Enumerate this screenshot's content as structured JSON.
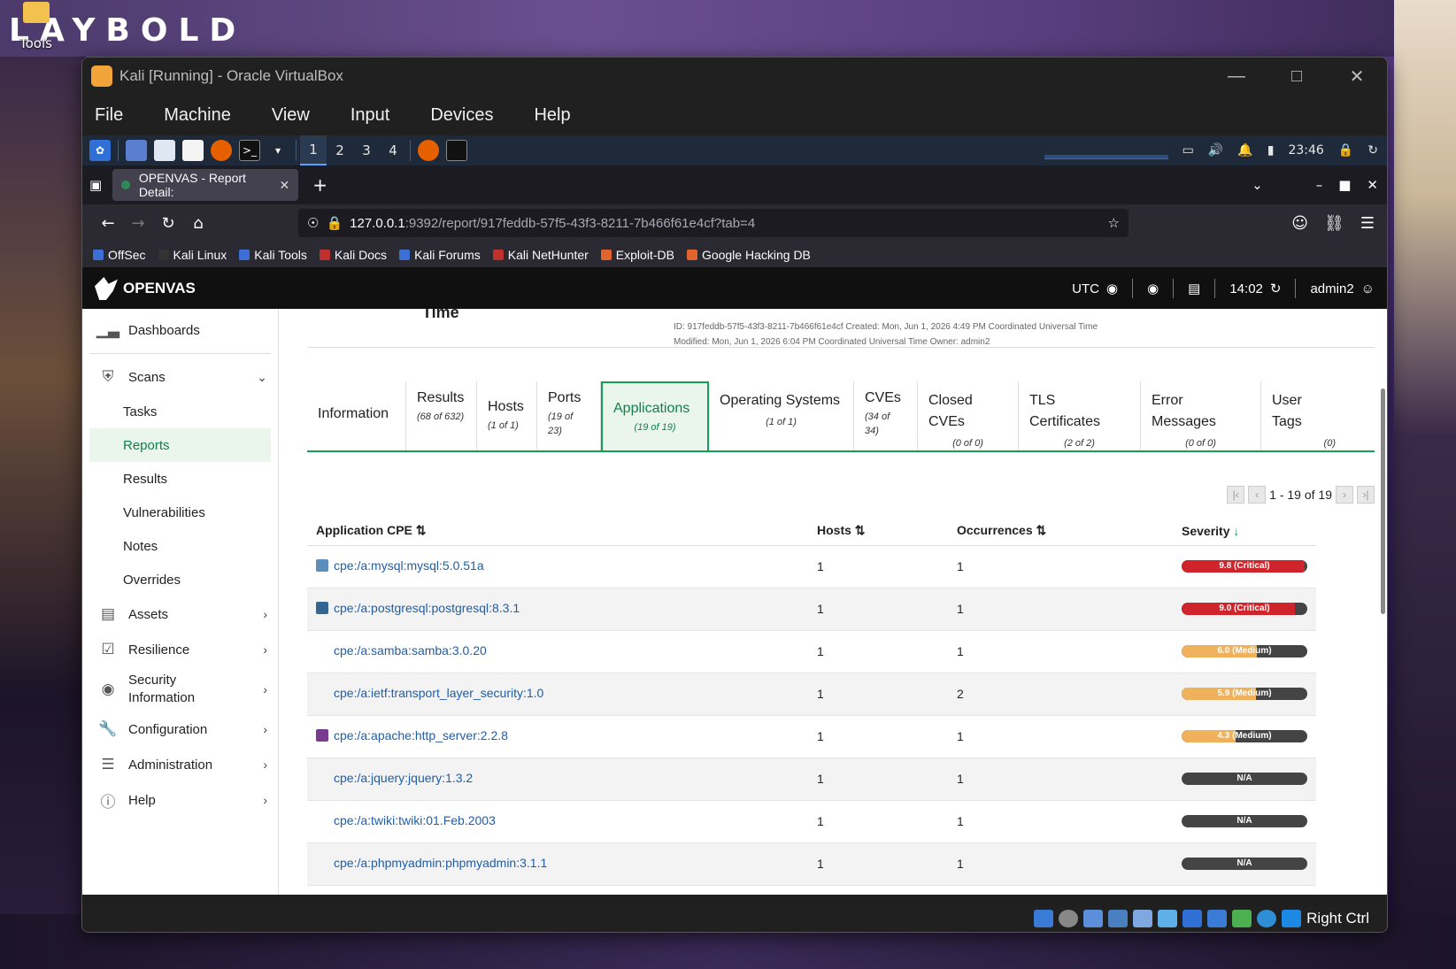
{
  "desktop": {
    "logo": "LAYBOLD",
    "tools_label": "Tools"
  },
  "vbox": {
    "title": "Kali [Running] - Oracle VirtualBox",
    "menu": [
      "File",
      "Machine",
      "View",
      "Input",
      "Devices",
      "Help"
    ],
    "status_right": "Right Ctrl"
  },
  "kali_panel": {
    "workspaces": [
      "1",
      "2",
      "3",
      "4"
    ],
    "clock": "23:46"
  },
  "firefox": {
    "tab_title": "OPENVAS - Report Detail:",
    "url_host": "127.0.0.1",
    "url_path": ":9392/report/917feddb-57f5-43f3-8211-7b466f61e4cf?tab=4",
    "bookmarks": [
      "OffSec",
      "Kali Linux",
      "Kali Tools",
      "Kali Docs",
      "Kali Forums",
      "Kali NetHunter",
      "Exploit-DB",
      "Google Hacking DB"
    ]
  },
  "openvas": {
    "brand": "OPENVAS",
    "timezone": "UTC",
    "time": "14:02",
    "user": "admin2",
    "sidebar": {
      "dashboards": "Dashboards",
      "scans": "Scans",
      "scans_sub": [
        "Tasks",
        "Reports",
        "Results",
        "Vulnerabilities",
        "Notes",
        "Overrides"
      ],
      "assets": "Assets",
      "resilience": "Resilience",
      "security_info": "Security Information",
      "configuration": "Configuration",
      "administration": "Administration",
      "help": "Help"
    },
    "report_meta": {
      "title_fragment": "Time",
      "line1": "ID: 917feddb-57f5-43f3-8211-7b466f61e4cf       Created: Mon, Jun 1, 2026 4:49 PM Coordinated Universal Time",
      "line2": "Modified: Mon, Jun 1, 2026 6:04 PM Coordinated Universal Time       Owner: admin2"
    },
    "tabs": [
      {
        "label": "Information",
        "sub": ""
      },
      {
        "label": "Results",
        "sub": "(68 of 632)"
      },
      {
        "label": "Hosts",
        "sub": "(1 of 1)"
      },
      {
        "label": "Ports",
        "sub": "(19 of 23)"
      },
      {
        "label": "Applications",
        "sub": "(19 of 19)"
      },
      {
        "label": "Operating Systems",
        "sub": "(1 of 1)"
      },
      {
        "label": "CVEs",
        "sub": "(34 of 34)"
      },
      {
        "label": "Closed CVEs",
        "sub": "(0 of 0)"
      },
      {
        "label": "TLS Certificates",
        "sub": "(2 of 2)"
      },
      {
        "label": "Error Messages",
        "sub": "(0 of 0)"
      },
      {
        "label": "User Tags",
        "sub": "(0)"
      }
    ],
    "pager": "1 - 19 of 19",
    "table": {
      "headers": [
        "Application CPE",
        "Hosts",
        "Occurrences",
        "Severity"
      ],
      "rows": [
        {
          "cpe": "cpe:/a:mysql:mysql:5.0.51a",
          "hosts": "1",
          "occ": "1",
          "sev": "9.8 (Critical)",
          "sev_frac": 0.98,
          "color": "#d0242c",
          "icon": "#5b8fb9"
        },
        {
          "cpe": "cpe:/a:postgresql:postgresql:8.3.1",
          "hosts": "1",
          "occ": "1",
          "sev": "9.0 (Critical)",
          "sev_frac": 0.9,
          "color": "#d0242c",
          "icon": "#336791"
        },
        {
          "cpe": "cpe:/a:samba:samba:3.0.20",
          "hosts": "1",
          "occ": "1",
          "sev": "6.0 (Medium)",
          "sev_frac": 0.6,
          "color": "#f0b15c",
          "icon": ""
        },
        {
          "cpe": "cpe:/a:ietf:transport_layer_security:1.0",
          "hosts": "1",
          "occ": "2",
          "sev": "5.9 (Medium)",
          "sev_frac": 0.59,
          "color": "#f0b15c",
          "icon": ""
        },
        {
          "cpe": "cpe:/a:apache:http_server:2.2.8",
          "hosts": "1",
          "occ": "1",
          "sev": "4.3 (Medium)",
          "sev_frac": 0.43,
          "color": "#f0b15c",
          "icon": "#7a3b8f"
        },
        {
          "cpe": "cpe:/a:jquery:jquery:1.3.2",
          "hosts": "1",
          "occ": "1",
          "sev": "N/A",
          "sev_frac": 0,
          "color": "#444444",
          "icon": ""
        },
        {
          "cpe": "cpe:/a:twiki:twiki:01.Feb.2003",
          "hosts": "1",
          "occ": "1",
          "sev": "N/A",
          "sev_frac": 0,
          "color": "#444444",
          "icon": ""
        },
        {
          "cpe": "cpe:/a:phpmyadmin:phpmyadmin:3.1.1",
          "hosts": "1",
          "occ": "1",
          "sev": "N/A",
          "sev_frac": 0,
          "color": "#444444",
          "icon": ""
        }
      ]
    }
  }
}
